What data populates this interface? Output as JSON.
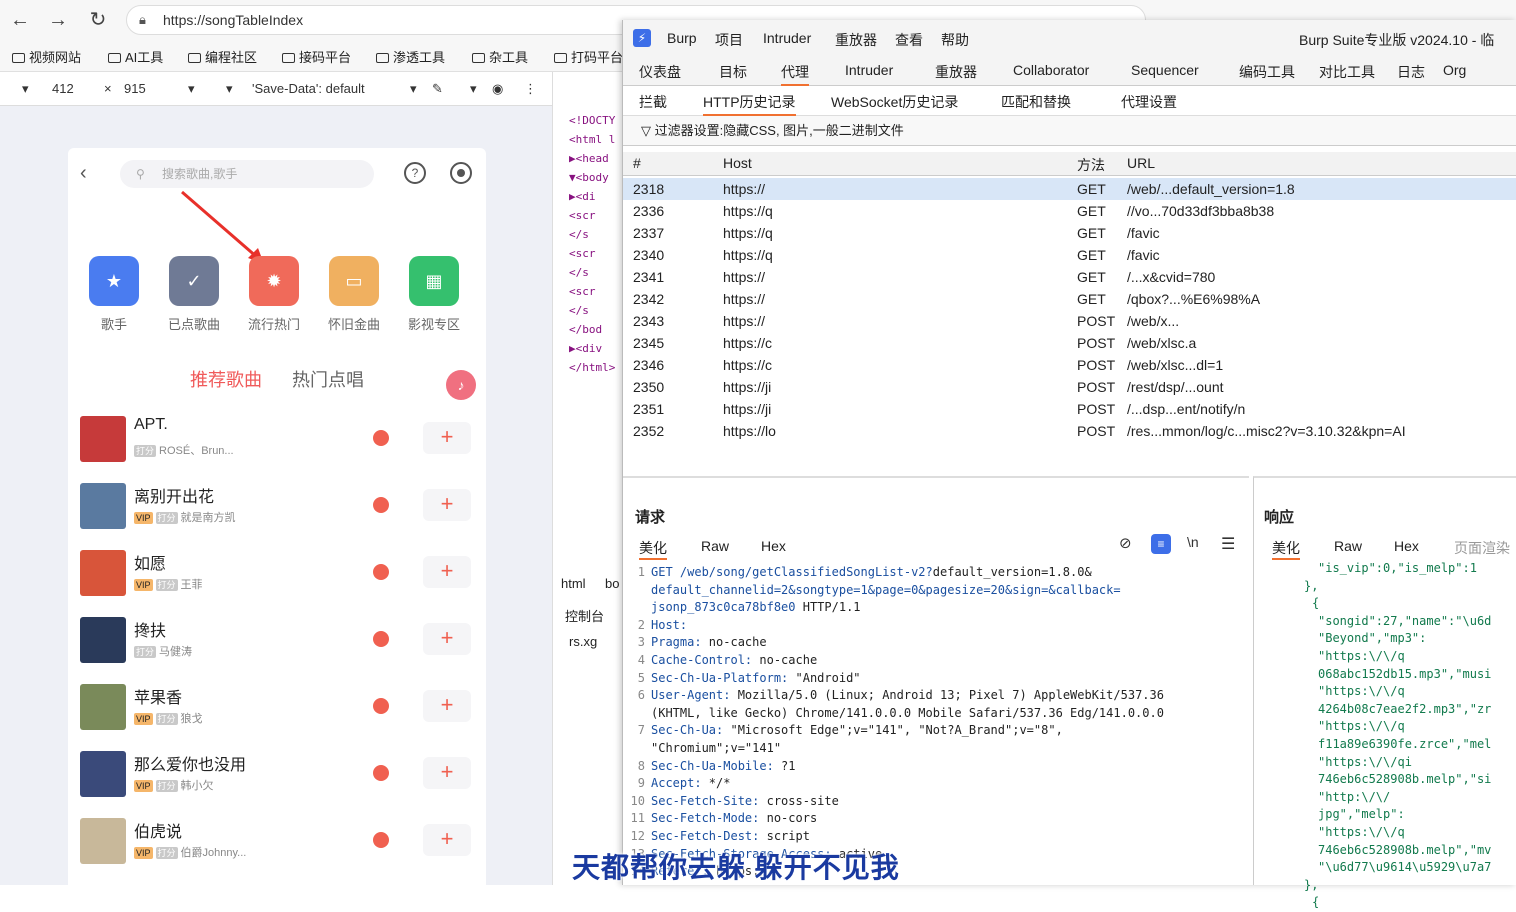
{
  "browser": {
    "url": "https://songTableIndex",
    "bookmarks": [
      "视频网站",
      "AI工具",
      "编程社区",
      "接码平台",
      "渗透工具",
      "杂工具",
      "打码平台"
    ],
    "devbar": {
      "width": "412",
      "x": "×",
      "height": "915",
      "save_data": "'Save-Data': default"
    }
  },
  "phone": {
    "search_placeholder": "搜索歌曲,歌手",
    "categories": [
      {
        "label": "歌手",
        "color": "#4a7cf0",
        "icon": "star-icon"
      },
      {
        "label": "已点歌曲",
        "color": "#6f7a95",
        "icon": "check-icon"
      },
      {
        "label": "流行热门",
        "color": "#f06a5a",
        "icon": "fire-icon"
      },
      {
        "label": "怀旧金曲",
        "color": "#f0b060",
        "icon": "tape-icon"
      },
      {
        "label": "影视专区",
        "color": "#35c06e",
        "icon": "film-icon"
      }
    ],
    "tab_active": "推荐歌曲",
    "tab_inactive": "热门点唱",
    "songs": [
      {
        "title": "APT.",
        "artist": "ROSÉ、Brun...",
        "vip": false,
        "cover": "#c63a3a"
      },
      {
        "title": "离别开出花",
        "artist": "就是南方凯",
        "vip": true,
        "cover": "#5a7aa0"
      },
      {
        "title": "如愿",
        "artist": "王菲",
        "vip": true,
        "cover": "#d8553a"
      },
      {
        "title": "搀扶",
        "artist": "马健涛",
        "vip": false,
        "cover": "#2a3a5a"
      },
      {
        "title": "苹果香",
        "artist": "狼戈",
        "vip": true,
        "cover": "#7a8a5a"
      },
      {
        "title": "那么爱你也没用",
        "artist": "韩小欠",
        "vip": true,
        "cover": "#3a4a7a"
      },
      {
        "title": "伯虎说",
        "artist": "伯爵Johnny...",
        "vip": true,
        "cover": "#c8b89a"
      }
    ],
    "tag_vip": "VIP",
    "tag_d": "打分"
  },
  "elements_lines": [
    "<!DOCTY",
    "<html l",
    "▶<head",
    "▼<body",
    "▶<di",
    "<scr",
    "</s",
    "<scr",
    "</s",
    "<scr",
    "</s",
    "</bod",
    "▶<div",
    "</html>"
  ],
  "elements_bottom": {
    "tab1": "html",
    "tab2": "bo",
    "console": "控制台",
    "search": "rs.xg"
  },
  "burp": {
    "menu": [
      "Burp",
      "项目",
      "Intruder",
      "重放器",
      "查看",
      "帮助"
    ],
    "title": "Burp Suite专业版  v2024.10 - 临",
    "tabs1": [
      "仪表盘",
      "目标",
      "代理",
      "Intruder",
      "重放器",
      "Collaborator",
      "Sequencer",
      "编码工具",
      "对比工具",
      "日志",
      "Org"
    ],
    "tabs2": [
      "拦截",
      "HTTP历史记录",
      "WebSocket历史记录",
      "匹配和替换",
      "代理设置"
    ],
    "filter": "过滤器设置:隐藏CSS, 图片,一般二进制文件",
    "cols": [
      "#",
      "Host",
      "方法",
      "URL"
    ],
    "rows": [
      {
        "n": "2318",
        "host": "https://",
        "m": "GET",
        "url": "/web/...default_version=1.8"
      },
      {
        "n": "2336",
        "host": "https://q",
        "m": "GET",
        "url": "//vo...70d33df3bba8b38"
      },
      {
        "n": "2337",
        "host": "https://q",
        "m": "GET",
        "url": "/favic"
      },
      {
        "n": "2340",
        "host": "https://q",
        "m": "GET",
        "url": "/favic"
      },
      {
        "n": "2341",
        "host": "https://",
        "m": "GET",
        "url": "/...x&cvid=780"
      },
      {
        "n": "2342",
        "host": "https://",
        "m": "GET",
        "url": "/qbox?...%E6%98%A"
      },
      {
        "n": "2343",
        "host": "https://",
        "m": "POST",
        "url": "/web/x..."
      },
      {
        "n": "2345",
        "host": "https://c",
        "m": "POST",
        "url": "/web/xlsc.a"
      },
      {
        "n": "2346",
        "host": "https://c",
        "m": "POST",
        "url": "/web/xlsc...dl=1"
      },
      {
        "n": "2350",
        "host": "https://ji",
        "m": "POST",
        "url": "/rest/dsp/...ount"
      },
      {
        "n": "2351",
        "host": "https://ji",
        "m": "POST",
        "url": "/...dsp...ent/notify/n"
      },
      {
        "n": "2352",
        "host": "https://lo",
        "m": "POST",
        "url": "/res...mmon/log/c...misc2?v=3.10.32&kpn=AI"
      }
    ],
    "req_title": "请求",
    "resp_title": "响应",
    "req_tabs": [
      "美化",
      "Raw",
      "Hex"
    ],
    "resp_tabs": [
      "美化",
      "Raw",
      "Hex",
      "页面渲染"
    ],
    "req_lines": [
      {
        "n": "1",
        "k": "GET /web/song/getClassifiedSongList-v2?",
        "v": "default_version=1.8.0&"
      },
      {
        "n": "",
        "k": "default_channelid=2&songtype=1&page=0&pagesize=20&sign=&callback=",
        "v": ""
      },
      {
        "n": "",
        "k": "jsonp_873c0ca78bf8e0",
        "v": " HTTP/1.1"
      },
      {
        "n": "2",
        "k": "Host:",
        "v": ""
      },
      {
        "n": "3",
        "k": "Pragma:",
        "v": " no-cache"
      },
      {
        "n": "4",
        "k": "Cache-Control:",
        "v": " no-cache"
      },
      {
        "n": "5",
        "k": "Sec-Ch-Ua-Platform:",
        "v": " \"Android\""
      },
      {
        "n": "6",
        "k": "User-Agent:",
        "v": " Mozilla/5.0 (Linux; Android 13; Pixel 7) AppleWebKit/537.36"
      },
      {
        "n": "",
        "k": "",
        "v": "(KHTML, like Gecko) Chrome/141.0.0.0 Mobile Safari/537.36 Edg/141.0.0.0"
      },
      {
        "n": "7",
        "k": "Sec-Ch-Ua:",
        "v": " \"Microsoft Edge\";v=\"141\", \"Not?A_Brand\";v=\"8\","
      },
      {
        "n": "",
        "k": "",
        "v": "\"Chromium\";v=\"141\""
      },
      {
        "n": "8",
        "k": "Sec-Ch-Ua-Mobile:",
        "v": " ?1"
      },
      {
        "n": "9",
        "k": "Accept:",
        "v": " */*"
      },
      {
        "n": "10",
        "k": "Sec-Fetch-Site:",
        "v": " cross-site"
      },
      {
        "n": "11",
        "k": "Sec-Fetch-Mode:",
        "v": " no-cors"
      },
      {
        "n": "12",
        "k": "Sec-Fetch-Dest:",
        "v": " script"
      },
      {
        "n": "13",
        "k": "Sec-Fetch-Storage-Access:",
        "v": " active"
      },
      {
        "n": "14",
        "k": "Referer:",
        "v": " https://"
      }
    ],
    "resp_lines": [
      "\"is_vip\":0,\"is_melp\":1",
      "},",
      "{",
      "\"songid\":27,\"name\":\"\\u6d",
      "\"Beyond\",\"mp3\":",
      "\"https:\\/\\/q",
      "068abc152db15.mp3\",\"musi",
      "\"https:\\/\\/q",
      "4264b08c7eae2f2.mp3\",\"zr",
      "\"https:\\/\\/q",
      "f11a89e6390fe.zrce\",\"mel",
      "\"https:\\/\\/qi",
      "746eb6c528908b.melp\",\"si",
      "\"http:\\/\\/",
      "jpg\",\"melp\":",
      "\"https:\\/\\/q",
      "746eb6c528908b.melp\",\"mv",
      "\"\\u6d77\\u9614\\u5929\\u7a7",
      "},",
      "{"
    ]
  },
  "subtitle": "天都帮你去躲  躲开不见我"
}
